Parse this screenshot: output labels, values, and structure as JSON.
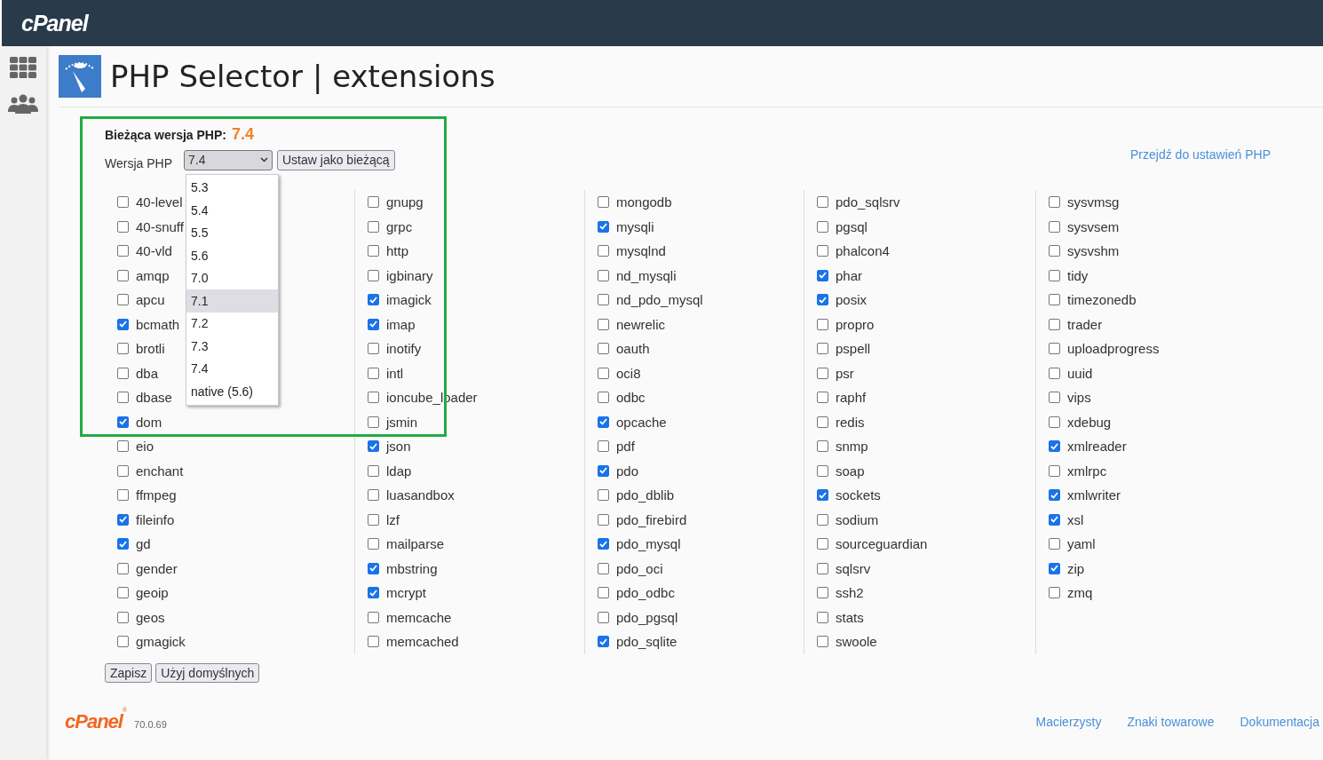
{
  "header": {
    "logo": "cPanel"
  },
  "page": {
    "title": "PHP Selector",
    "separator": "|",
    "subtitle": "extensions"
  },
  "current_version": {
    "label": "Bieżąca wersja PHP:",
    "value": "7.4"
  },
  "version_select": {
    "label": "Wersja PHP",
    "value": "7.4",
    "set_button": "Ustaw jako bieżącą",
    "expanded": true,
    "options": [
      {
        "label": "5.3",
        "highlighted": false
      },
      {
        "label": "5.4",
        "highlighted": false
      },
      {
        "label": "5.5",
        "highlighted": false
      },
      {
        "label": "5.6",
        "highlighted": false
      },
      {
        "label": "7.0",
        "highlighted": false
      },
      {
        "label": "7.1",
        "highlighted": true
      },
      {
        "label": "7.2",
        "highlighted": false
      },
      {
        "label": "7.3",
        "highlighted": false
      },
      {
        "label": "7.4",
        "highlighted": false
      },
      {
        "label": "native (5.6)",
        "highlighted": false
      }
    ]
  },
  "settings_link": "Przejdź do ustawień PHP",
  "columns": [
    {
      "items": [
        {
          "name": "40-level",
          "checked": false
        },
        {
          "name": "40-snuff",
          "checked": false
        },
        {
          "name": "40-vld",
          "checked": false
        },
        {
          "name": "amqp",
          "checked": false
        },
        {
          "name": "apcu",
          "checked": false
        },
        {
          "name": "bcmath",
          "checked": true
        },
        {
          "name": "brotli",
          "checked": false
        },
        {
          "name": "dba",
          "checked": false
        },
        {
          "name": "dbase",
          "checked": false
        },
        {
          "name": "dom",
          "checked": true
        },
        {
          "name": "eio",
          "checked": false
        },
        {
          "name": "enchant",
          "checked": false
        },
        {
          "name": "ffmpeg",
          "checked": false
        },
        {
          "name": "fileinfo",
          "checked": true
        },
        {
          "name": "gd",
          "checked": true
        },
        {
          "name": "gender",
          "checked": false
        },
        {
          "name": "geoip",
          "checked": false
        },
        {
          "name": "geos",
          "checked": false
        },
        {
          "name": "gmagick",
          "checked": false
        }
      ]
    },
    {
      "items": [
        {
          "name": "gnupg",
          "checked": false
        },
        {
          "name": "grpc",
          "checked": false
        },
        {
          "name": "http",
          "checked": false
        },
        {
          "name": "igbinary",
          "checked": false
        },
        {
          "name": "imagick",
          "checked": true
        },
        {
          "name": "imap",
          "checked": true
        },
        {
          "name": "inotify",
          "checked": false
        },
        {
          "name": "intl",
          "checked": false
        },
        {
          "name": "ioncube_loader",
          "checked": false
        },
        {
          "name": "jsmin",
          "checked": false
        },
        {
          "name": "json",
          "checked": true
        },
        {
          "name": "ldap",
          "checked": false
        },
        {
          "name": "luasandbox",
          "checked": false
        },
        {
          "name": "lzf",
          "checked": false
        },
        {
          "name": "mailparse",
          "checked": false
        },
        {
          "name": "mbstring",
          "checked": true
        },
        {
          "name": "mcrypt",
          "checked": true
        },
        {
          "name": "memcache",
          "checked": false
        },
        {
          "name": "memcached",
          "checked": false
        }
      ]
    },
    {
      "items": [
        {
          "name": "mongodb",
          "checked": false
        },
        {
          "name": "mysqli",
          "checked": true
        },
        {
          "name": "mysqlnd",
          "checked": false
        },
        {
          "name": "nd_mysqli",
          "checked": false
        },
        {
          "name": "nd_pdo_mysql",
          "checked": false
        },
        {
          "name": "newrelic",
          "checked": false
        },
        {
          "name": "oauth",
          "checked": false
        },
        {
          "name": "oci8",
          "checked": false
        },
        {
          "name": "odbc",
          "checked": false
        },
        {
          "name": "opcache",
          "checked": true
        },
        {
          "name": "pdf",
          "checked": false
        },
        {
          "name": "pdo",
          "checked": true
        },
        {
          "name": "pdo_dblib",
          "checked": false
        },
        {
          "name": "pdo_firebird",
          "checked": false
        },
        {
          "name": "pdo_mysql",
          "checked": true
        },
        {
          "name": "pdo_oci",
          "checked": false
        },
        {
          "name": "pdo_odbc",
          "checked": false
        },
        {
          "name": "pdo_pgsql",
          "checked": false
        },
        {
          "name": "pdo_sqlite",
          "checked": true
        }
      ]
    },
    {
      "items": [
        {
          "name": "pdo_sqlsrv",
          "checked": false
        },
        {
          "name": "pgsql",
          "checked": false
        },
        {
          "name": "phalcon4",
          "checked": false
        },
        {
          "name": "phar",
          "checked": true
        },
        {
          "name": "posix",
          "checked": true
        },
        {
          "name": "propro",
          "checked": false
        },
        {
          "name": "pspell",
          "checked": false
        },
        {
          "name": "psr",
          "checked": false
        },
        {
          "name": "raphf",
          "checked": false
        },
        {
          "name": "redis",
          "checked": false
        },
        {
          "name": "snmp",
          "checked": false
        },
        {
          "name": "soap",
          "checked": false
        },
        {
          "name": "sockets",
          "checked": true
        },
        {
          "name": "sodium",
          "checked": false
        },
        {
          "name": "sourceguardian",
          "checked": false
        },
        {
          "name": "sqlsrv",
          "checked": false
        },
        {
          "name": "ssh2",
          "checked": false
        },
        {
          "name": "stats",
          "checked": false
        },
        {
          "name": "swoole",
          "checked": false
        }
      ]
    },
    {
      "items": [
        {
          "name": "sysvmsg",
          "checked": false
        },
        {
          "name": "sysvsem",
          "checked": false
        },
        {
          "name": "sysvshm",
          "checked": false
        },
        {
          "name": "tidy",
          "checked": false
        },
        {
          "name": "timezonedb",
          "checked": false
        },
        {
          "name": "trader",
          "checked": false
        },
        {
          "name": "uploadprogress",
          "checked": false
        },
        {
          "name": "uuid",
          "checked": false
        },
        {
          "name": "vips",
          "checked": false
        },
        {
          "name": "xdebug",
          "checked": false
        },
        {
          "name": "xmlreader",
          "checked": true
        },
        {
          "name": "xmlrpc",
          "checked": false
        },
        {
          "name": "xmlwriter",
          "checked": true
        },
        {
          "name": "xsl",
          "checked": true
        },
        {
          "name": "yaml",
          "checked": false
        },
        {
          "name": "zip",
          "checked": true
        },
        {
          "name": "zmq",
          "checked": false
        }
      ]
    }
  ],
  "buttons": [
    "Zapisz",
    "Użyj domyślnych"
  ],
  "footer": {
    "logo": "cPanel",
    "logo_mark": "®",
    "version": "70.0.69",
    "links": [
      "Macierzysty",
      "Znaki towarowe",
      "Dokumentacja"
    ]
  }
}
